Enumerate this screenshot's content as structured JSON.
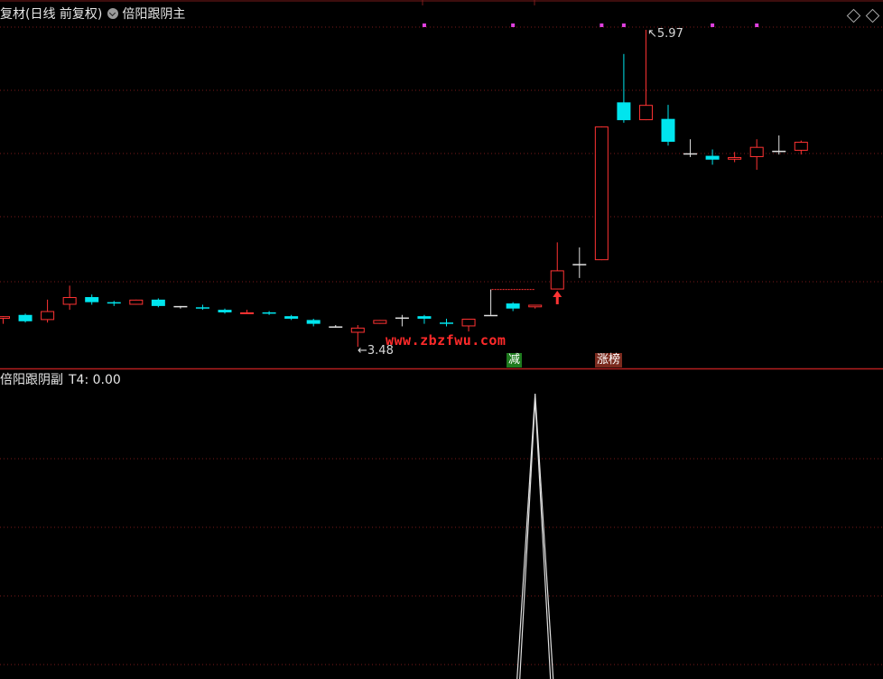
{
  "header": {
    "main_title": "复材(日线 前复权)",
    "indicator_main": "倍阳跟阴主",
    "indicator_sub": "倍阳跟阴副",
    "sub_value": "T4: 0.00"
  },
  "labels": {
    "high_price": "5.97",
    "low_price": "3.48",
    "badge_jian": "减",
    "badge_zhangbang": "涨榜",
    "watermark": "www.zbzfwu.com"
  },
  "colors": {
    "up": "#ff3333",
    "down": "#00e5ee",
    "flat": "#e0e0e0",
    "divider": "#b41e1e",
    "grid": "#7a1a1a",
    "signal_dot": "#e040e0",
    "indicator_line": "#e0e0e0"
  },
  "chart_data": {
    "type": "candlestick",
    "title": "复材(日线 前复权)",
    "ohlc": [
      {
        "o": 3.7,
        "h": 3.72,
        "l": 3.66,
        "c": 3.72
      },
      {
        "o": 3.73,
        "h": 3.74,
        "l": 3.67,
        "c": 3.68
      },
      {
        "o": 3.69,
        "h": 3.85,
        "l": 3.67,
        "c": 3.76
      },
      {
        "o": 3.81,
        "h": 3.96,
        "l": 3.77,
        "c": 3.87
      },
      {
        "o": 3.87,
        "h": 3.89,
        "l": 3.81,
        "c": 3.83
      },
      {
        "o": 3.83,
        "h": 3.84,
        "l": 3.8,
        "c": 3.82
      },
      {
        "o": 3.81,
        "h": 3.85,
        "l": 3.81,
        "c": 3.85
      },
      {
        "o": 3.85,
        "h": 3.86,
        "l": 3.79,
        "c": 3.8
      },
      {
        "o": 3.8,
        "h": 3.8,
        "l": 3.78,
        "c": 3.8
      },
      {
        "o": 3.79,
        "h": 3.81,
        "l": 3.77,
        "c": 3.78
      },
      {
        "o": 3.77,
        "h": 3.78,
        "l": 3.74,
        "c": 3.75
      },
      {
        "o": 3.74,
        "h": 3.77,
        "l": 3.74,
        "c": 3.75
      },
      {
        "o": 3.75,
        "h": 3.76,
        "l": 3.73,
        "c": 3.74
      },
      {
        "o": 3.72,
        "h": 3.73,
        "l": 3.69,
        "c": 3.7
      },
      {
        "o": 3.69,
        "h": 3.7,
        "l": 3.64,
        "c": 3.66
      },
      {
        "o": 3.64,
        "h": 3.65,
        "l": 3.63,
        "c": 3.64
      },
      {
        "o": 3.59,
        "h": 3.65,
        "l": 3.48,
        "c": 3.63
      },
      {
        "o": 3.66,
        "h": 3.69,
        "l": 3.66,
        "c": 3.69
      },
      {
        "o": 3.71,
        "h": 3.73,
        "l": 3.64,
        "c": 3.71
      },
      {
        "o": 3.72,
        "h": 3.73,
        "l": 3.66,
        "c": 3.7
      },
      {
        "o": 3.67,
        "h": 3.7,
        "l": 3.64,
        "c": 3.66
      },
      {
        "o": 3.64,
        "h": 3.7,
        "l": 3.6,
        "c": 3.7
      },
      {
        "o": 3.73,
        "h": 3.93,
        "l": 3.73,
        "c": 3.73
      },
      {
        "o": 3.82,
        "h": 3.83,
        "l": 3.76,
        "c": 3.78
      },
      {
        "o": 3.79,
        "h": 3.81,
        "l": 3.78,
        "c": 3.81
      },
      {
        "o": 3.93,
        "h": 4.3,
        "l": 3.93,
        "c": 4.08
      },
      {
        "o": 4.13,
        "h": 4.26,
        "l": 4.02,
        "c": 4.13
      },
      {
        "o": 4.16,
        "h": 5.21,
        "l": 4.16,
        "c": 5.21
      },
      {
        "o": 5.4,
        "h": 5.78,
        "l": 5.24,
        "c": 5.26
      },
      {
        "o": 5.26,
        "h": 5.97,
        "l": 5.26,
        "c": 5.38
      },
      {
        "o": 5.27,
        "h": 5.38,
        "l": 5.06,
        "c": 5.09
      },
      {
        "o": 5.0,
        "h": 5.11,
        "l": 4.97,
        "c": 5.0
      },
      {
        "o": 4.98,
        "h": 5.03,
        "l": 4.91,
        "c": 4.95
      },
      {
        "o": 4.95,
        "h": 5.01,
        "l": 4.93,
        "c": 4.97
      },
      {
        "o": 4.97,
        "h": 5.11,
        "l": 4.87,
        "c": 5.05
      },
      {
        "o": 5.02,
        "h": 5.14,
        "l": 4.99,
        "c": 5.02
      },
      {
        "o": 5.02,
        "h": 5.1,
        "l": 4.99,
        "c": 5.09
      }
    ],
    "high_marker_index": 29,
    "low_marker_index": 16,
    "signal_dot_indices": [
      19,
      23,
      27,
      28,
      32,
      34
    ],
    "up_arrow_index": 25,
    "badge_jian_index": 23,
    "badge_zhangbang_index": 27,
    "step_line": {
      "start_index": 22,
      "end_index": 24,
      "value": 3.93
    },
    "indicator": {
      "name": "T4",
      "values": [
        0,
        0,
        0,
        0,
        0,
        0,
        0,
        0,
        0,
        0,
        0,
        0,
        0,
        0,
        0,
        0,
        0,
        0,
        0,
        0,
        0,
        0,
        0,
        0,
        1,
        0,
        0,
        0,
        0,
        0,
        0,
        0,
        0,
        0,
        0,
        0,
        0
      ]
    }
  }
}
